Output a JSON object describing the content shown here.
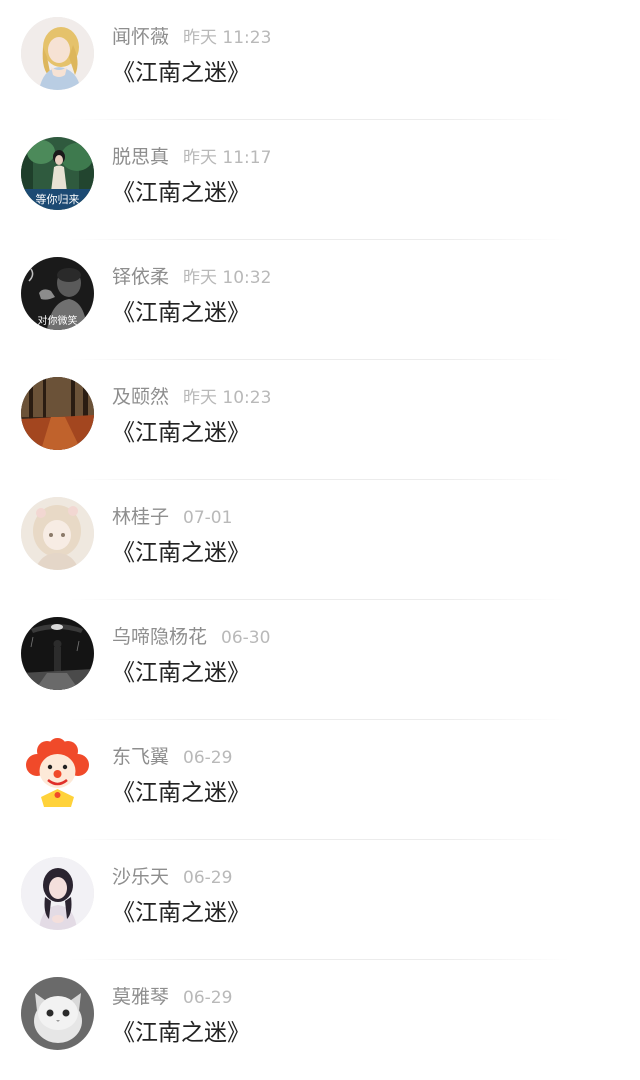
{
  "comments": [
    {
      "name": "闻怀薇",
      "time": "昨天 11:23",
      "content": "《江南之迷》",
      "avatar_icon": "girl-illustration-avatar-icon"
    },
    {
      "name": "脱思真",
      "time": "昨天 11:17",
      "content": "《江南之迷》",
      "avatar_icon": "girl-in-forest-avatar-icon",
      "avatar_caption": "等你归来"
    },
    {
      "name": "铎依柔",
      "time": "昨天 10:32",
      "content": "《江南之迷》",
      "avatar_icon": "man-smoking-avatar-icon",
      "avatar_caption": "对你微笑"
    },
    {
      "name": "及颐然",
      "time": "昨天 10:23",
      "content": "《江南之迷》",
      "avatar_icon": "autumn-road-avatar-icon"
    },
    {
      "name": "林桂子",
      "time": "07-01",
      "content": "《江南之迷》",
      "avatar_icon": "anime-girl-avatar-icon"
    },
    {
      "name": "乌啼隐杨花",
      "time": "06-30",
      "content": "《江南之迷》",
      "avatar_icon": "rainy-night-avatar-icon"
    },
    {
      "name": "东飞翼",
      "time": "06-29",
      "content": "《江南之迷》",
      "avatar_icon": "clown-avatar-icon"
    },
    {
      "name": "沙乐天",
      "time": "06-29",
      "content": "《江南之迷》",
      "avatar_icon": "woman-portrait-avatar-icon"
    },
    {
      "name": "莫雅琴",
      "time": "06-29",
      "content": "《江南之迷》",
      "avatar_icon": "white-kitten-avatar-icon"
    }
  ]
}
